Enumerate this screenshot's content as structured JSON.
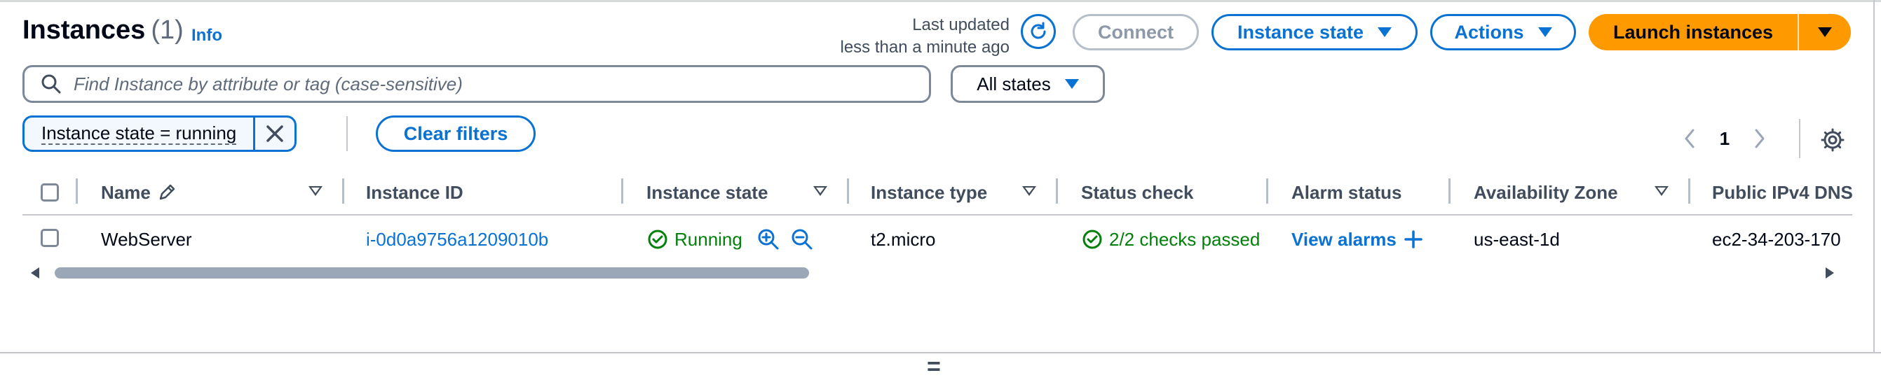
{
  "header": {
    "title": "Instances",
    "count": "(1)",
    "info_link": "Info",
    "last_updated_line1": "Last updated",
    "last_updated_line2": "less than a minute ago",
    "connect_label": "Connect",
    "instance_state_label": "Instance state",
    "actions_label": "Actions",
    "launch_label": "Launch instances"
  },
  "search": {
    "placeholder": "Find Instance by attribute or tag (case-sensitive)",
    "states_select": "All states"
  },
  "filters": {
    "token_label": "Instance state = running",
    "clear_label": "Clear filters"
  },
  "pagination": {
    "current_page": "1"
  },
  "table": {
    "columns": {
      "name": "Name",
      "instance_id": "Instance ID",
      "instance_state": "Instance state",
      "instance_type": "Instance type",
      "status_check": "Status check",
      "alarm_status": "Alarm status",
      "availability_zone": "Availability Zone",
      "public_dns": "Public IPv4 DNS"
    },
    "rows": [
      {
        "name": "WebServer",
        "instance_id": "i-0d0a9756a1209010b",
        "state": "Running",
        "type": "t2.micro",
        "status_check": "2/2 checks passed",
        "alarm": "View alarms",
        "zone": "us-east-1d",
        "dns": "ec2-34-203-170"
      }
    ]
  },
  "colors": {
    "link_blue": "#0972d3",
    "launch_orange": "#ff9900",
    "success_green": "#037f0c"
  }
}
